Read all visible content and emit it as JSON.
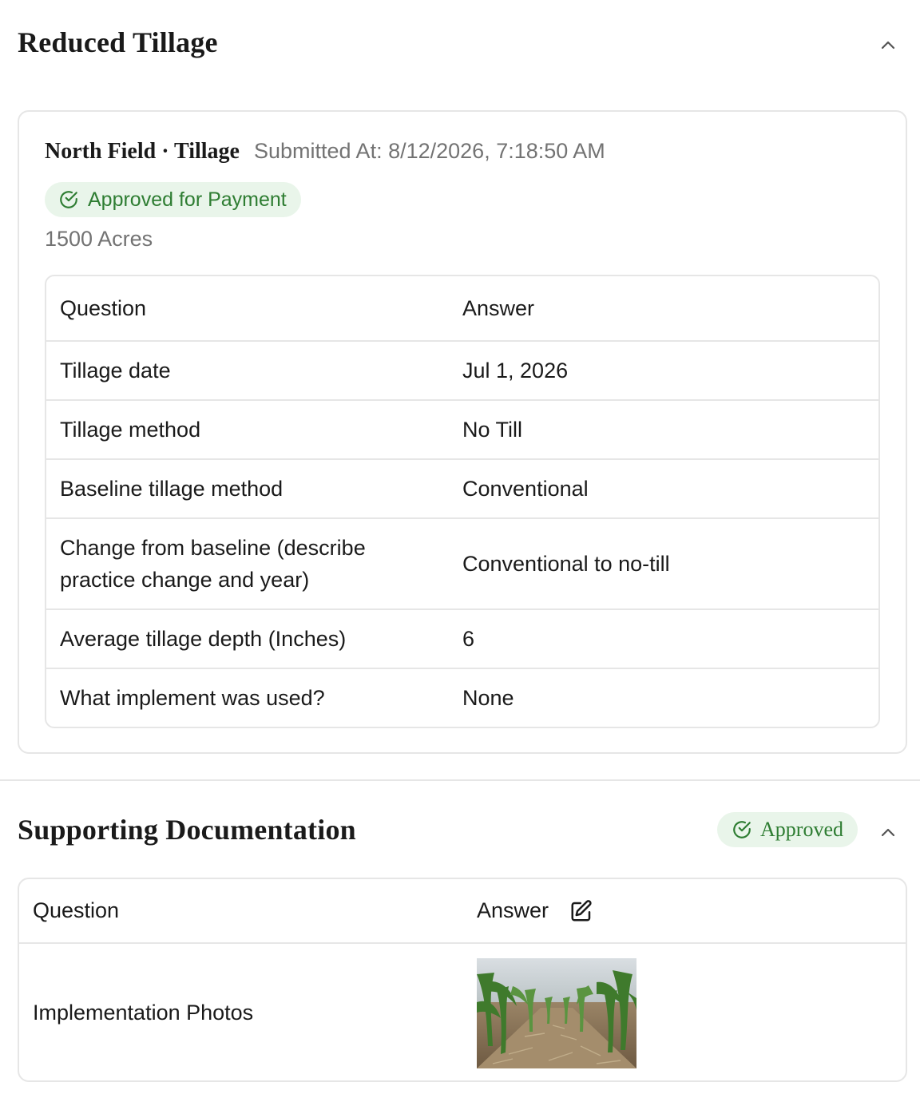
{
  "section1": {
    "title": "Reduced Tillage",
    "field_name": "North Field · Tillage",
    "submitted": "Submitted At: 8/12/2026, 7:18:50 AM",
    "status": "Approved for Payment",
    "acres": "1500 Acres",
    "table": {
      "headers": [
        "Question",
        "Answer"
      ],
      "rows": [
        {
          "question": "Tillage date",
          "answer": "Jul 1, 2026"
        },
        {
          "question": "Tillage method",
          "answer": "No Till"
        },
        {
          "question": "Baseline tillage method",
          "answer": "Conventional"
        },
        {
          "question": "Change from baseline (describe practice change and year)",
          "answer": "Conventional to no-till"
        },
        {
          "question": "Average tillage depth (Inches)",
          "answer": "6"
        },
        {
          "question": "What implement was used?",
          "answer": "None"
        }
      ]
    }
  },
  "section2": {
    "title": "Supporting Documentation",
    "status": "Approved",
    "table": {
      "headers": [
        "Question",
        "Answer"
      ],
      "rows": [
        {
          "question": "Implementation Photos",
          "answer_image": "corn-field-photo"
        }
      ]
    }
  },
  "colors": {
    "approved_green": "#2e7d32",
    "approved_bg": "#e9f5ea",
    "border": "#e6e6e6",
    "muted_text": "#737373"
  },
  "icons": {
    "collapse": "chevron-up-icon",
    "status": "check-circle-icon",
    "edit": "edit-icon"
  }
}
